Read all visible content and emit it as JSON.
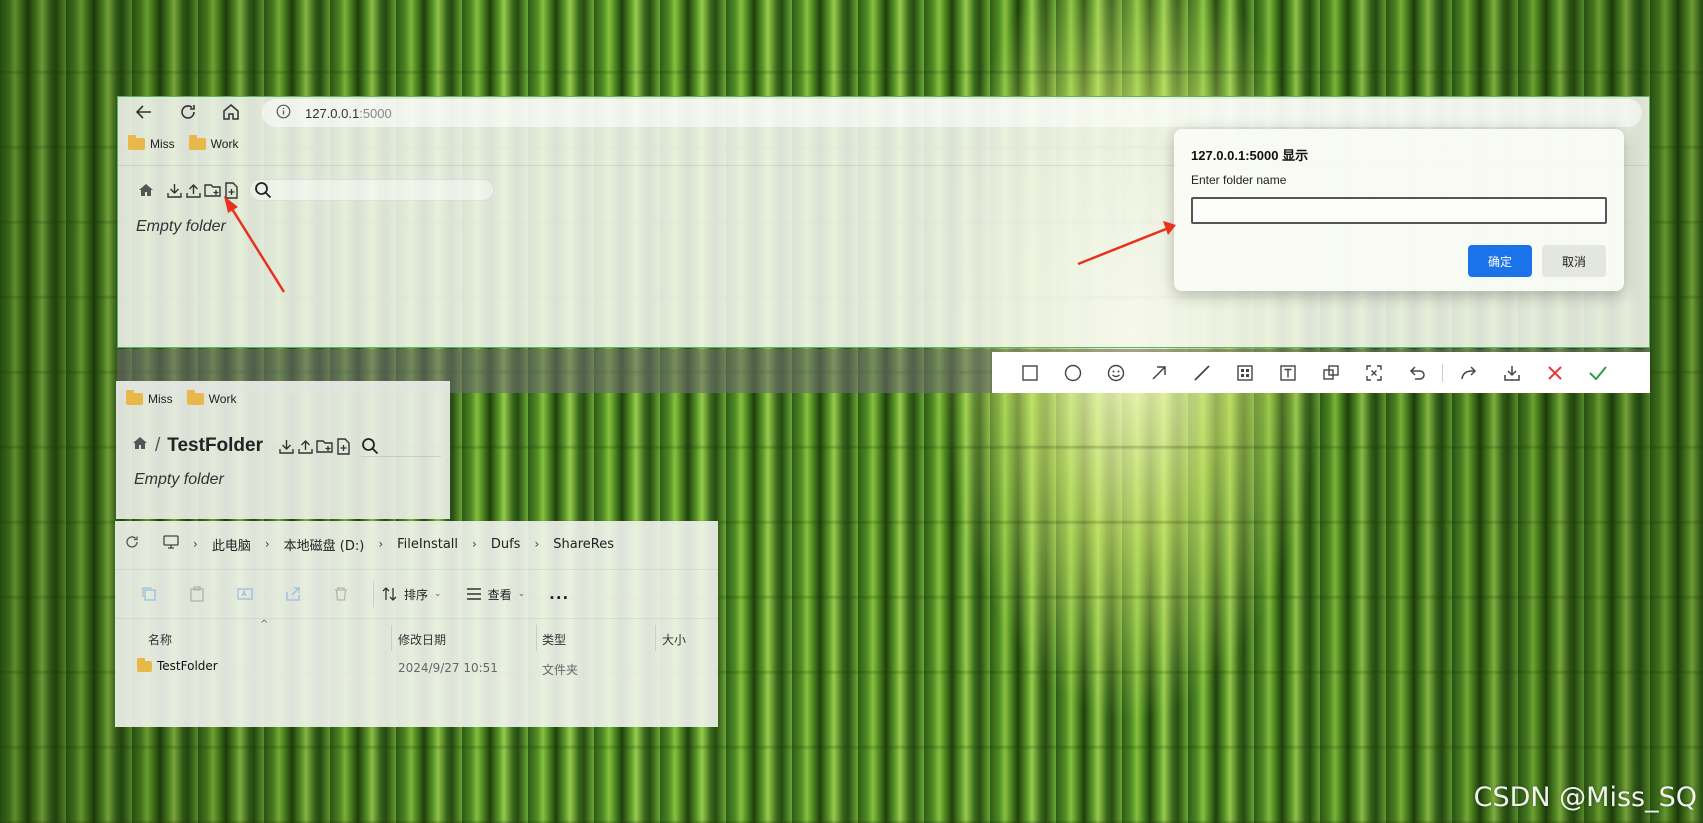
{
  "browser": {
    "url_host": "127.0.0.1",
    "url_port": ":5000",
    "bookmarks": [
      {
        "label": "Miss"
      },
      {
        "label": "Work"
      }
    ],
    "empty_text": "Empty folder",
    "search_placeholder": ""
  },
  "dialog": {
    "title": "127.0.0.1:5000 显示",
    "message": "Enter folder name",
    "input_value": "",
    "ok_label": "确定",
    "cancel_label": "取消",
    "ok_color": "#1a73e8"
  },
  "snip_toolbar": {
    "icons": [
      "rectangle-icon",
      "ellipse-icon",
      "emoji-icon",
      "arrow-icon",
      "line-icon",
      "mosaic-icon",
      "text-icon",
      "pin-icon",
      "ocr-icon",
      "undo-icon",
      "redo-icon",
      "save-icon",
      "close-icon",
      "confirm-icon"
    ],
    "close_color": "#e53935",
    "confirm_color": "#2e9e44"
  },
  "small_panel": {
    "bookmarks": [
      {
        "label": "Miss"
      },
      {
        "label": "Work"
      }
    ],
    "separator": "/",
    "folder_name": "TestFolder",
    "empty_text": "Empty folder"
  },
  "explorer": {
    "breadcrumb": [
      "此电脑",
      "本地磁盘 (D:)",
      "FileInstall",
      "Dufs",
      "ShareRes"
    ],
    "sort_label": "排序",
    "view_label": "查看",
    "more_label": "...",
    "columns": {
      "name": "名称",
      "modified": "修改日期",
      "type": "类型",
      "size": "大小"
    },
    "rows": [
      {
        "name": "TestFolder",
        "modified": "2024/9/27 10:51",
        "type": "文件夹",
        "size": ""
      }
    ]
  },
  "watermark": "CSDN @Miss_SQ",
  "annotation_color": "#e8321e"
}
